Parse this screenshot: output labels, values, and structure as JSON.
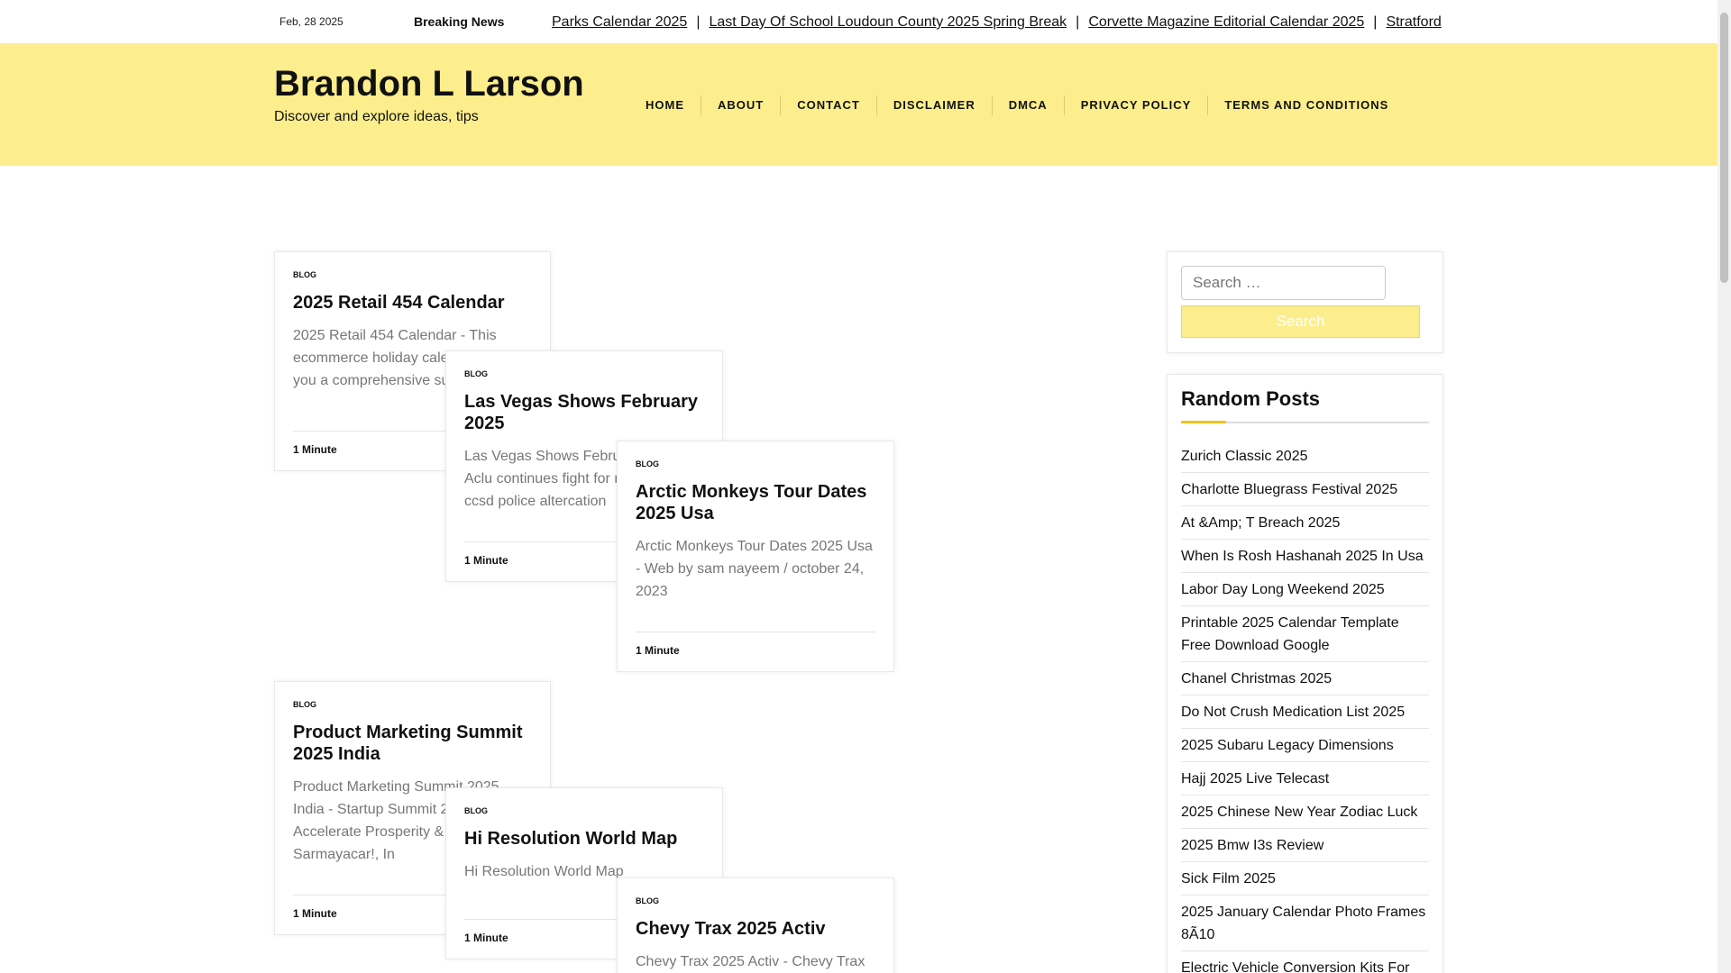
{
  "topbar": {
    "date": "Feb, 28 2025",
    "breaking_label": "Breaking News",
    "ticker": [
      "Parks Calendar 2025",
      "Last Day Of School Loudoun County 2025 Spring Break",
      "Corvette Magazine Editorial Calendar 2025",
      "Stratford"
    ],
    "separator": "|"
  },
  "header": {
    "site_title": "Brandon L Larson",
    "tagline": "Discover and explore ideas, tips",
    "nav": [
      "HOME",
      "ABOUT",
      "CONTACT",
      "DISCLAIMER",
      "DMCA",
      "PRIVACY POLICY",
      "TERMS AND CONDITIONS"
    ]
  },
  "posts": [
    {
      "category": "BLOG",
      "title": "2025 Retail 454 Calendar",
      "excerpt": "2025 Retail 454 Calendar - This ecommerce holiday calendar gives you a comprehensive su",
      "read_time": "1 Minute"
    },
    {
      "category": "BLOG",
      "title": "Las Vegas Shows February 2025",
      "excerpt": "Las Vegas Shows February 2025 - Aclu continues fight for release of ccsd police altercation",
      "read_time": "1 Minute"
    },
    {
      "category": "BLOG",
      "title": "Arctic Monkeys Tour Dates 2025 Usa",
      "excerpt": "Arctic Monkeys Tour Dates 2025 Usa - Web by sam nayeem / october 24, 2023",
      "read_time": "1 Minute"
    },
    {
      "category": "BLOG",
      "title": "Product Marketing Summit 2025 India",
      "excerpt": "Product Marketing Summit 2025 India - Startup Summit 2025 Accelerate Prosperity & Sarmayacar!, In",
      "read_time": "1 Minute"
    },
    {
      "category": "BLOG",
      "title": "Hi Resolution World Map",
      "excerpt": "Hi Resolution World Map",
      "read_time": "1 Minute"
    },
    {
      "category": "BLOG",
      "title": "Chevy Trax 2025 Activ",
      "excerpt": "Chevy Trax 2025 Activ - Chevy Trax",
      "read_time": "1 Minute"
    }
  ],
  "sidebar": {
    "search_placeholder": "Search …",
    "search_button": "Search",
    "random_posts_title": "Random Posts",
    "random_posts": [
      "Zurich Classic 2025",
      "Charlotte Bluegrass Festival 2025",
      "At &Amp; T Breach 2025",
      "When Is Rosh Hashanah 2025 In Usa",
      "Labor Day Long Weekend 2025",
      "Printable 2025 Calendar Template Free Download Google",
      "Chanel Christmas 2025",
      "Do Not Crush Medication List 2025",
      "2025 Subaru Legacy Dimensions",
      "Hajj 2025 Live Telecast",
      "2025 Chinese New Year Zodiac Luck",
      "2025 Bmw I3s Review",
      "Sick Film 2025",
      "2025 January Calendar Photo Frames 8Ã10",
      "Electric Vehicle Conversion Kits For"
    ]
  },
  "colors": {
    "header_bg": "#fcee8c",
    "accent": "#f0c419"
  }
}
